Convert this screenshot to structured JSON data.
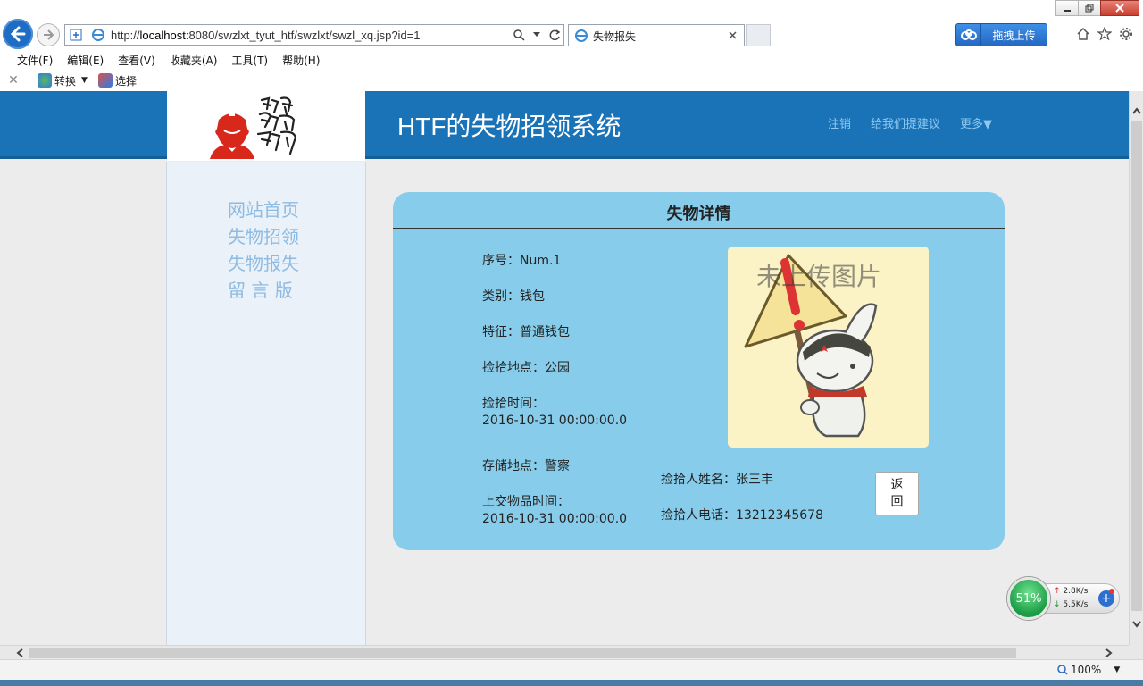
{
  "browser": {
    "url_prefix": "http://",
    "url_host": "localhost",
    "url_rest": ":8080/swzlxt_tyut_htf/swzlxt/swzl_xq.jsp?id=1",
    "tab_title": "失物报失",
    "baidu_button": "拖拽上传",
    "menu": [
      "文件(F)",
      "编辑(E)",
      "查看(V)",
      "收藏夹(A)",
      "工具(T)",
      "帮助(H)"
    ],
    "toolbar": {
      "convert": "转换",
      "select": "选择"
    },
    "zoom": "100%"
  },
  "site": {
    "title": "HTF的失物招领系统",
    "topnav": [
      "注销",
      "给我们提建议",
      "更多▼"
    ]
  },
  "sidebar": {
    "items": [
      "网站首页",
      "失物招领",
      "失物报失",
      "留 言 版"
    ]
  },
  "detail": {
    "heading": "失物详情",
    "serial": "序号：Num.1",
    "category": "类别：钱包",
    "feature": "特征：普通钱包",
    "pickup_place": "捡拾地点：公园",
    "pickup_time_label": "捡拾时间：",
    "pickup_time": "2016-10-31 00:00:00.0",
    "storage_place": "存储地点：警察",
    "submit_time_label": "上交物品时间：",
    "submit_time": "2016-10-31 00:00:00.0",
    "finder_name": "捡拾人姓名：张三丰",
    "finder_phone": "捡拾人电话：13212345678",
    "photo_placeholder": "未上传图片",
    "return_button": [
      "返",
      "回"
    ]
  },
  "net_widget": {
    "cpu": "51%",
    "up": "2.8K/s",
    "down": "5.5K/s"
  },
  "colors": {
    "header_blue": "#1a73b7",
    "card_blue": "#87cdeb",
    "sidebar_link": "#8dbbe3",
    "page_bg": "#ececec"
  }
}
